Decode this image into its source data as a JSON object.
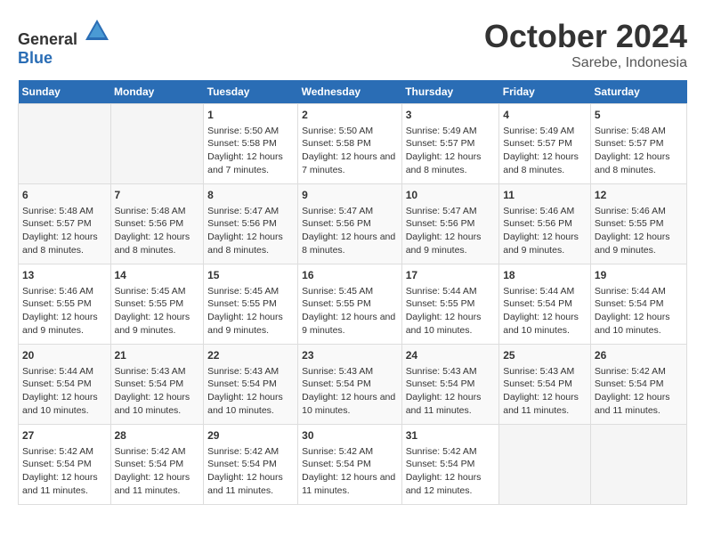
{
  "logo": {
    "general": "General",
    "blue": "Blue"
  },
  "title": "October 2024",
  "subtitle": "Sarebe, Indonesia",
  "weekdays": [
    "Sunday",
    "Monday",
    "Tuesday",
    "Wednesday",
    "Thursday",
    "Friday",
    "Saturday"
  ],
  "weeks": [
    [
      {
        "day": "",
        "empty": true
      },
      {
        "day": "",
        "empty": true
      },
      {
        "day": "1",
        "sunrise": "Sunrise: 5:50 AM",
        "sunset": "Sunset: 5:58 PM",
        "daylight": "Daylight: 12 hours and 7 minutes."
      },
      {
        "day": "2",
        "sunrise": "Sunrise: 5:50 AM",
        "sunset": "Sunset: 5:58 PM",
        "daylight": "Daylight: 12 hours and 7 minutes."
      },
      {
        "day": "3",
        "sunrise": "Sunrise: 5:49 AM",
        "sunset": "Sunset: 5:57 PM",
        "daylight": "Daylight: 12 hours and 8 minutes."
      },
      {
        "day": "4",
        "sunrise": "Sunrise: 5:49 AM",
        "sunset": "Sunset: 5:57 PM",
        "daylight": "Daylight: 12 hours and 8 minutes."
      },
      {
        "day": "5",
        "sunrise": "Sunrise: 5:48 AM",
        "sunset": "Sunset: 5:57 PM",
        "daylight": "Daylight: 12 hours and 8 minutes."
      }
    ],
    [
      {
        "day": "6",
        "sunrise": "Sunrise: 5:48 AM",
        "sunset": "Sunset: 5:57 PM",
        "daylight": "Daylight: 12 hours and 8 minutes."
      },
      {
        "day": "7",
        "sunrise": "Sunrise: 5:48 AM",
        "sunset": "Sunset: 5:56 PM",
        "daylight": "Daylight: 12 hours and 8 minutes."
      },
      {
        "day": "8",
        "sunrise": "Sunrise: 5:47 AM",
        "sunset": "Sunset: 5:56 PM",
        "daylight": "Daylight: 12 hours and 8 minutes."
      },
      {
        "day": "9",
        "sunrise": "Sunrise: 5:47 AM",
        "sunset": "Sunset: 5:56 PM",
        "daylight": "Daylight: 12 hours and 8 minutes."
      },
      {
        "day": "10",
        "sunrise": "Sunrise: 5:47 AM",
        "sunset": "Sunset: 5:56 PM",
        "daylight": "Daylight: 12 hours and 9 minutes."
      },
      {
        "day": "11",
        "sunrise": "Sunrise: 5:46 AM",
        "sunset": "Sunset: 5:56 PM",
        "daylight": "Daylight: 12 hours and 9 minutes."
      },
      {
        "day": "12",
        "sunrise": "Sunrise: 5:46 AM",
        "sunset": "Sunset: 5:55 PM",
        "daylight": "Daylight: 12 hours and 9 minutes."
      }
    ],
    [
      {
        "day": "13",
        "sunrise": "Sunrise: 5:46 AM",
        "sunset": "Sunset: 5:55 PM",
        "daylight": "Daylight: 12 hours and 9 minutes."
      },
      {
        "day": "14",
        "sunrise": "Sunrise: 5:45 AM",
        "sunset": "Sunset: 5:55 PM",
        "daylight": "Daylight: 12 hours and 9 minutes."
      },
      {
        "day": "15",
        "sunrise": "Sunrise: 5:45 AM",
        "sunset": "Sunset: 5:55 PM",
        "daylight": "Daylight: 12 hours and 9 minutes."
      },
      {
        "day": "16",
        "sunrise": "Sunrise: 5:45 AM",
        "sunset": "Sunset: 5:55 PM",
        "daylight": "Daylight: 12 hours and 9 minutes."
      },
      {
        "day": "17",
        "sunrise": "Sunrise: 5:44 AM",
        "sunset": "Sunset: 5:55 PM",
        "daylight": "Daylight: 12 hours and 10 minutes."
      },
      {
        "day": "18",
        "sunrise": "Sunrise: 5:44 AM",
        "sunset": "Sunset: 5:54 PM",
        "daylight": "Daylight: 12 hours and 10 minutes."
      },
      {
        "day": "19",
        "sunrise": "Sunrise: 5:44 AM",
        "sunset": "Sunset: 5:54 PM",
        "daylight": "Daylight: 12 hours and 10 minutes."
      }
    ],
    [
      {
        "day": "20",
        "sunrise": "Sunrise: 5:44 AM",
        "sunset": "Sunset: 5:54 PM",
        "daylight": "Daylight: 12 hours and 10 minutes."
      },
      {
        "day": "21",
        "sunrise": "Sunrise: 5:43 AM",
        "sunset": "Sunset: 5:54 PM",
        "daylight": "Daylight: 12 hours and 10 minutes."
      },
      {
        "day": "22",
        "sunrise": "Sunrise: 5:43 AM",
        "sunset": "Sunset: 5:54 PM",
        "daylight": "Daylight: 12 hours and 10 minutes."
      },
      {
        "day": "23",
        "sunrise": "Sunrise: 5:43 AM",
        "sunset": "Sunset: 5:54 PM",
        "daylight": "Daylight: 12 hours and 10 minutes."
      },
      {
        "day": "24",
        "sunrise": "Sunrise: 5:43 AM",
        "sunset": "Sunset: 5:54 PM",
        "daylight": "Daylight: 12 hours and 11 minutes."
      },
      {
        "day": "25",
        "sunrise": "Sunrise: 5:43 AM",
        "sunset": "Sunset: 5:54 PM",
        "daylight": "Daylight: 12 hours and 11 minutes."
      },
      {
        "day": "26",
        "sunrise": "Sunrise: 5:42 AM",
        "sunset": "Sunset: 5:54 PM",
        "daylight": "Daylight: 12 hours and 11 minutes."
      }
    ],
    [
      {
        "day": "27",
        "sunrise": "Sunrise: 5:42 AM",
        "sunset": "Sunset: 5:54 PM",
        "daylight": "Daylight: 12 hours and 11 minutes."
      },
      {
        "day": "28",
        "sunrise": "Sunrise: 5:42 AM",
        "sunset": "Sunset: 5:54 PM",
        "daylight": "Daylight: 12 hours and 11 minutes."
      },
      {
        "day": "29",
        "sunrise": "Sunrise: 5:42 AM",
        "sunset": "Sunset: 5:54 PM",
        "daylight": "Daylight: 12 hours and 11 minutes."
      },
      {
        "day": "30",
        "sunrise": "Sunrise: 5:42 AM",
        "sunset": "Sunset: 5:54 PM",
        "daylight": "Daylight: 12 hours and 11 minutes."
      },
      {
        "day": "31",
        "sunrise": "Sunrise: 5:42 AM",
        "sunset": "Sunset: 5:54 PM",
        "daylight": "Daylight: 12 hours and 12 minutes."
      },
      {
        "day": "",
        "empty": true
      },
      {
        "day": "",
        "empty": true
      }
    ]
  ]
}
